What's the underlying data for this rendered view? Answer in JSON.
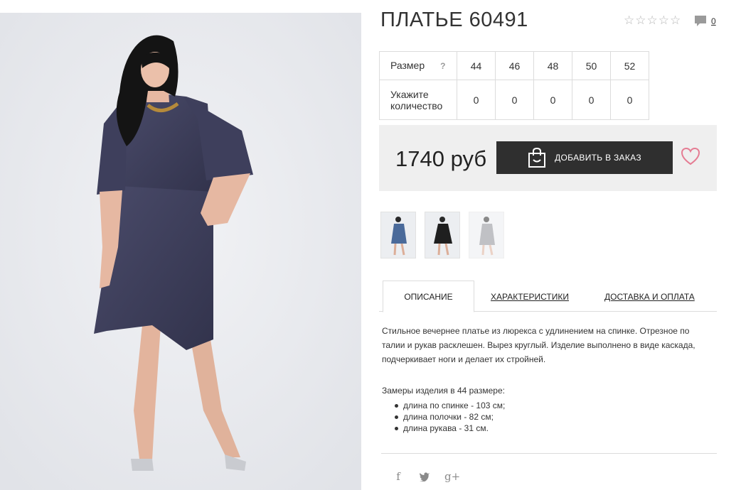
{
  "product": {
    "title": "ПЛАТЬЕ 60491",
    "rating_stars": 5,
    "rating_value": 0,
    "comment_count": "0"
  },
  "sizes": {
    "size_label": "Размер",
    "help_icon": "?",
    "qty_label": "Укажите количество",
    "values": [
      "44",
      "46",
      "48",
      "50",
      "52"
    ],
    "quantities": [
      "0",
      "0",
      "0",
      "0",
      "0"
    ]
  },
  "buy": {
    "price": "1740 руб",
    "add_button_label": "ДОБАВИТЬ В ЗАКАЗ",
    "bag_icon": "shopping-bag-icon",
    "wishlist_icon": "heart-icon"
  },
  "thumbnails": [
    {
      "name": "blue dress",
      "color": "#4a6a9a"
    },
    {
      "name": "black dress",
      "color": "#1f1f1f"
    },
    {
      "name": "grey dress",
      "color": "#8d8f96"
    }
  ],
  "tabs": [
    {
      "label": "ОПИСАНИЕ",
      "active": true
    },
    {
      "label": "ХАРАКТЕРИСТИКИ",
      "active": false
    },
    {
      "label": "ДОСТАВКА И ОПЛАТА",
      "active": false
    }
  ],
  "description": {
    "text": "Стильное вечернее платье из люрекса с удлинением на спинке. Отрезное по талии и рукав расклешен. Вырез круглый. Изделие выполнено в виде каскада, подчеркивает ноги и делает их стройней.",
    "measures_title": "Замеры изделия в 44 размере:",
    "measures": [
      "длина по спинке - 103 см;",
      "длина полочки - 82 см;",
      "длина рукава - 31 см."
    ]
  },
  "social": {
    "facebook": "f",
    "twitter": "twitter-icon",
    "gplus": "g+"
  },
  "colors": {
    "button_bg": "#2f2f2f",
    "heart": "#e57c93",
    "dress": "#3f3f5c",
    "box_bg": "#efefef"
  }
}
